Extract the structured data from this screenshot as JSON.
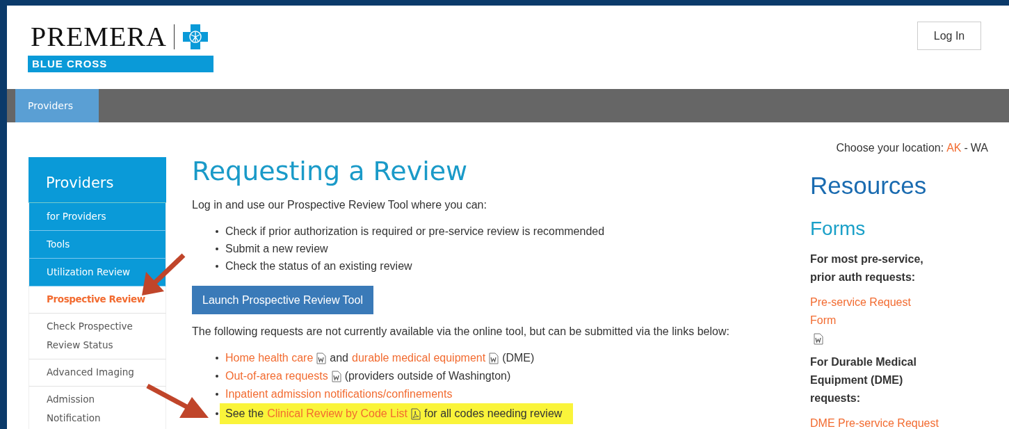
{
  "logo": {
    "name": "PREMERA",
    "tagline": "BLUE CROSS"
  },
  "login": {
    "label": "Log In"
  },
  "nav": [
    {
      "label": "Providers",
      "selected": true
    }
  ],
  "location": {
    "label": "Choose your location:",
    "separator": "-",
    "options": [
      {
        "label": "AK",
        "selected": false
      },
      {
        "label": "WA",
        "selected": true
      }
    ]
  },
  "sidebar": {
    "title": "Providers",
    "items": [
      {
        "label": "for Providers",
        "kind": "parent",
        "selected": false
      },
      {
        "label": "Tools",
        "kind": "parent",
        "selected": false
      },
      {
        "label": "Utilization Review",
        "kind": "parent",
        "selected": false
      },
      {
        "label": "Prospective Review",
        "kind": "child",
        "selected": true
      },
      {
        "label": "Check Prospective Review Status",
        "kind": "child",
        "selected": false
      },
      {
        "label": "Advanced Imaging",
        "kind": "child",
        "selected": false
      },
      {
        "label": "Admission Notification",
        "kind": "child",
        "selected": false
      }
    ]
  },
  "main": {
    "title": "Requesting a Review",
    "intro": "Log in and use our Prospective Review Tool where you can:",
    "bullets": [
      "Check if prior authorization is required or pre-service review is recommended",
      "Submit a new review",
      "Check the status of an existing review"
    ],
    "button": "Launch Prospective Review Tool",
    "note": "The following requests are not currently available via the online tool, but can be submitted via the links below:",
    "requests": [
      {
        "highlighted": false,
        "parts": [
          {
            "kind": "link",
            "text": "Home health care"
          },
          {
            "kind": "word-file"
          },
          {
            "kind": "text",
            "text": "and"
          },
          {
            "kind": "link",
            "text": "durable medical equipment"
          },
          {
            "kind": "word-file"
          },
          {
            "kind": "text",
            "text": "(DME)"
          }
        ]
      },
      {
        "highlighted": false,
        "parts": [
          {
            "kind": "link",
            "text": "Out-of-area requests"
          },
          {
            "kind": "word-file"
          },
          {
            "kind": "text",
            "text": "(providers outside of Washington)"
          }
        ]
      },
      {
        "highlighted": false,
        "parts": [
          {
            "kind": "link",
            "text": "Inpatient admission notifications/confinements"
          }
        ]
      },
      {
        "highlighted": true,
        "parts": [
          {
            "kind": "text",
            "text": "See the"
          },
          {
            "kind": "link",
            "text": "Clinical Review by Code List"
          },
          {
            "kind": "pdf-file"
          },
          {
            "kind": "text",
            "text": "for all codes needing review"
          }
        ]
      }
    ]
  },
  "resources": {
    "title": "Resources",
    "section": "Forms",
    "groups": [
      {
        "heading": "For most pre-service, prior auth requests:",
        "link": "Pre-service Request Form",
        "attachment": true
      },
      {
        "heading": "For Durable Medical Equipment (DME) requests:",
        "link": "DME Pre-service Request",
        "attachment": false
      }
    ]
  }
}
